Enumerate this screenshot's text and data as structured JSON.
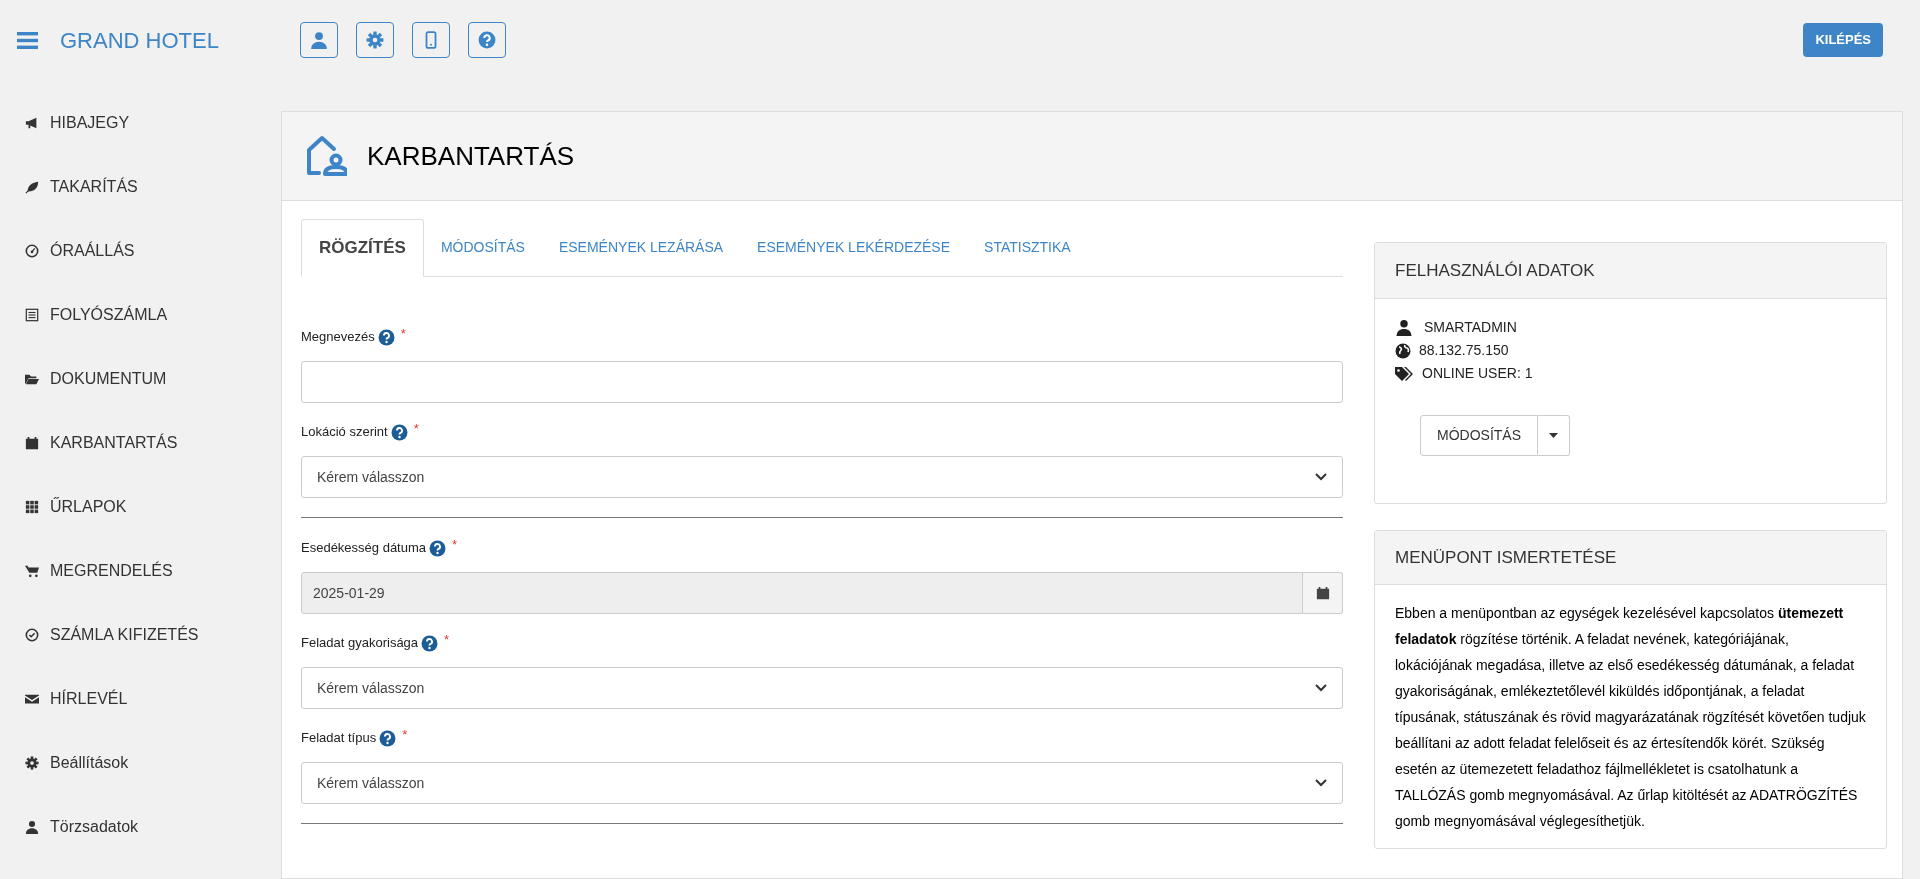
{
  "app": {
    "title": "GRAND HOTEL"
  },
  "toolbar_buttons": [
    {
      "kind": "user"
    },
    {
      "kind": "gear"
    },
    {
      "kind": "phone"
    },
    {
      "kind": "help"
    }
  ],
  "logout_button": "KILÉPÉS",
  "sidebar": {
    "items": [
      {
        "label": "HIBAJEGY",
        "kind": "megaphone"
      },
      {
        "label": "TAKARÍTÁS",
        "kind": "leaf"
      },
      {
        "label": "ÓRAÁLLÁS",
        "kind": "gauge"
      },
      {
        "label": "FOLYÓSZÁMLA",
        "kind": "list"
      },
      {
        "label": "DOKUMENTUM",
        "kind": "folder"
      },
      {
        "label": "KARBANTARTÁS",
        "kind": "calendar"
      },
      {
        "label": "ŰRLAPOK",
        "kind": "grid"
      },
      {
        "label": "MEGRENDELÉS",
        "kind": "cart"
      },
      {
        "label": "SZÁMLA KIFIZETÉS",
        "kind": "check"
      },
      {
        "label": "HÍRLEVÉL",
        "kind": "envelope"
      },
      {
        "label": "Beállítások",
        "kind": "gear"
      },
      {
        "label": "Törzsadatok",
        "kind": "user"
      }
    ]
  },
  "page": {
    "title": "KARBANTARTÁS"
  },
  "tabs": [
    {
      "label": "RÖGZÍTÉS",
      "selected": true
    },
    {
      "label": "MÓDOSÍTÁS",
      "selected": false
    },
    {
      "label": "ESEMÉNYEK LEZÁRÁSA",
      "selected": false
    },
    {
      "label": "ESEMÉNYEK LEKÉRDEZÉSE",
      "selected": false
    },
    {
      "label": "STATISZTIKA",
      "selected": false
    }
  ],
  "form": {
    "fields": [
      {
        "kind": "text",
        "label": "Megnevezés",
        "required_mark": "*"
      },
      {
        "kind": "select",
        "label": "Lokáció szerint",
        "required_mark": "*",
        "value": "Kérem válasszon"
      },
      {
        "kind": "divider"
      },
      {
        "kind": "date",
        "label": "Esedékesség dátuma",
        "required_mark": "*",
        "value": "2025-01-29"
      },
      {
        "kind": "select",
        "label": "Feladat gyakorisága",
        "required_mark": "*",
        "value": "Kérem válasszon"
      },
      {
        "kind": "select",
        "label": "Feladat típus",
        "required_mark": "*",
        "value": "Kérem válasszon"
      },
      {
        "kind": "divider"
      }
    ]
  },
  "user_panel": {
    "title": "FELHASZNÁLÓI ADATOK",
    "username": "SMARTADMIN",
    "ip": "88.132.75.150",
    "online_users": "ONLINE USER: 1",
    "button": "MÓDOSÍTÁS"
  },
  "info_panel": {
    "title": "MENÜPONT ISMERTETÉSE",
    "text": "Ebben a menüpontban az egységek kezelésével kapcsolatos **ütemezett feladatok** rögzítése történik. A feladat nevének, kategóriájának, lokációjának megadása, illetve az első esedékesség dátumának, a feladat gyakoriságának, emlékeztetőlevél kiküldés időpontjának, a feladat típusának, státuszának és rövid magyarázatának rögzítését követően tudjuk beállítani az adott feladat felelőseit és az értesítendők körét. Szükség esetén az ütemezetett feladathoz fájlmellékletet is csatolhatunk a TALLÓZÁS gomb megnyomásával. Az űrlap kitöltését az ADATRÖGZÍTÉS gomb megnyomásával véglegesíthetjük."
  }
}
